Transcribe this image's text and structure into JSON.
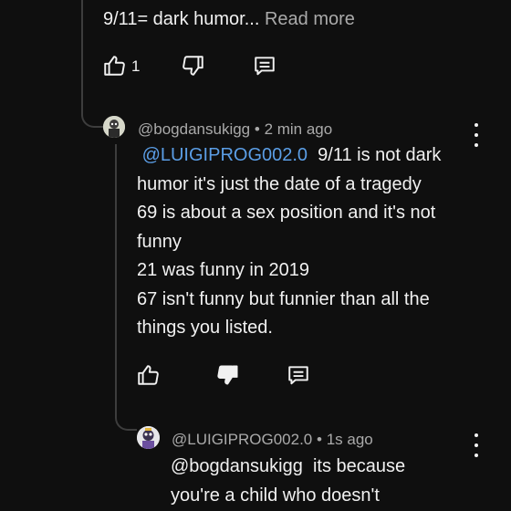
{
  "comment_parent": {
    "text_line": "9/11= dark humor...",
    "read_more": "Read more",
    "like_count": "1"
  },
  "reply_1": {
    "handle": "@bogdansukigg",
    "separator": "•",
    "time": "2 min ago",
    "mention": "@LUIGIPROG002.0",
    "lines": [
      "9/11 is not dark",
      "humor it's just the date of a tragedy",
      "69 is about a sex position and it's not",
      "funny",
      "21 was funny in 2019",
      "67 isn't funny but funnier than all the",
      "things you listed."
    ]
  },
  "reply_2": {
    "handle": "@LUIGIPROG002.0",
    "separator": "•",
    "time": "1s ago",
    "mention": "@bogdansukigg",
    "lines": [
      "its because",
      "you're a child who doesn't"
    ]
  },
  "icons": {
    "like": "thumbs-up-icon",
    "dislike": "thumbs-down-icon",
    "reply": "reply-comment-icon",
    "more": "more-vertical-icon"
  },
  "colors": {
    "background": "#0f0f0f",
    "text": "#f1f1f1",
    "meta": "#aaaaaa",
    "mention": "#5b9ee6",
    "thread_line": "#3d3d3d"
  }
}
